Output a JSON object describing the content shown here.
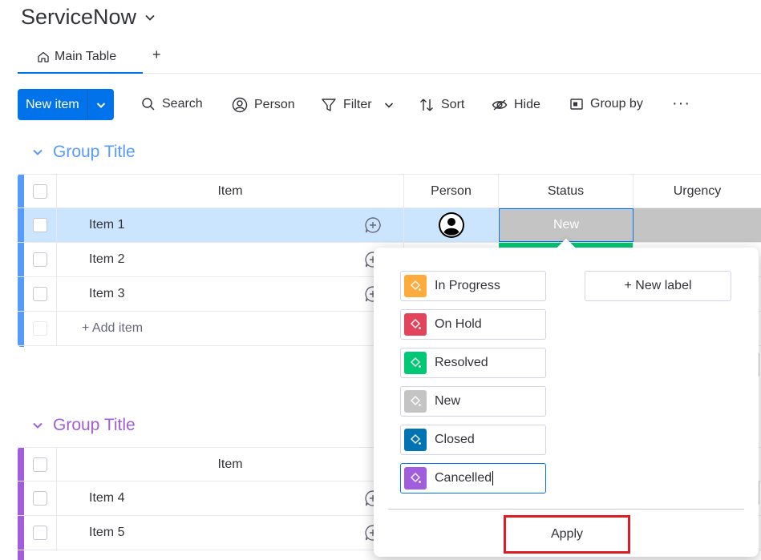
{
  "board": {
    "title": "ServiceNow"
  },
  "tabs": {
    "main_label": "Main Table",
    "add_label": "+"
  },
  "toolbar": {
    "new_item_label": "New item",
    "search_label": "Search",
    "person_label": "Person",
    "filter_label": "Filter",
    "sort_label": "Sort",
    "hide_label": "Hide",
    "group_by_label": "Group by",
    "more_label": "···"
  },
  "groups": [
    {
      "title": "Group Title",
      "color": "#579bfc",
      "columns": [
        "Item",
        "Person",
        "Status",
        "Urgency"
      ],
      "items": [
        {
          "name": "Item 1",
          "status": "New"
        },
        {
          "name": "Item 2"
        },
        {
          "name": "Item 3"
        }
      ],
      "add_item_label": "+ Add item"
    },
    {
      "title": "Group Title",
      "color": "#a25ddc",
      "columns": [
        "Item"
      ],
      "items": [
        {
          "name": "Item 4"
        },
        {
          "name": "Item 5"
        }
      ]
    }
  ],
  "status_popup": {
    "labels": [
      {
        "text": "In Progress",
        "color": "#fdab3d"
      },
      {
        "text": "On Hold",
        "color": "#e2445c"
      },
      {
        "text": "Resolved",
        "color": "#00c875"
      },
      {
        "text": "New",
        "color": "#c4c4c4"
      },
      {
        "text": "Closed",
        "color": "#0073b3"
      },
      {
        "text": "Cancelled",
        "color": "#a25ddc"
      }
    ],
    "new_label_text": "+ New label",
    "apply_label": "Apply"
  },
  "colors": {
    "accent": "#0073ea",
    "selected_row": "#cce5ff",
    "status_new": "#c4c4c4",
    "status_resolved": "#00c875",
    "highlight_border": "#e01b24"
  }
}
